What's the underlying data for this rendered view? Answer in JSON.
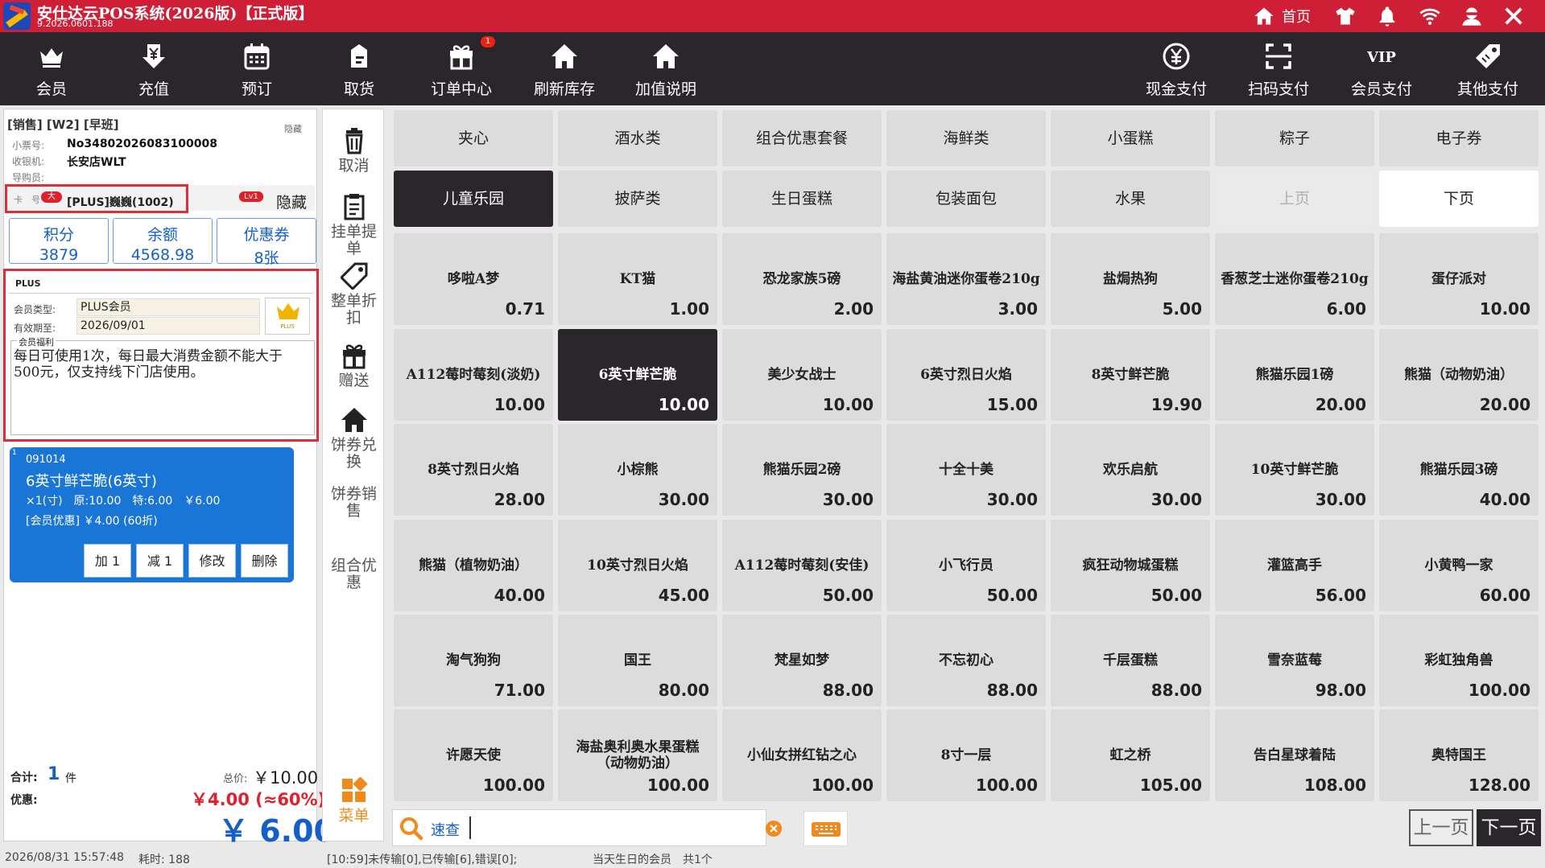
{
  "window": {
    "title": "安仕达云POS系统(2026版)【正式版】",
    "version": "9.2026.0601.188",
    "home_label": "首页"
  },
  "toolbar": {
    "left": [
      {
        "label": "会员",
        "icon": "crown-icon"
      },
      {
        "label": "充值",
        "icon": "yen-download-icon"
      },
      {
        "label": "预订",
        "icon": "calendar-icon"
      },
      {
        "label": "取货",
        "icon": "package-icon"
      },
      {
        "label": "订单中心",
        "icon": "gift-icon",
        "badge": "1"
      },
      {
        "label": "刷新库存",
        "icon": "house-icon"
      },
      {
        "label": "加值说明",
        "icon": "house-icon"
      }
    ],
    "right": [
      {
        "label": "现金支付",
        "icon": "yen-circle-icon"
      },
      {
        "label": "扫码支付",
        "icon": "scan-icon"
      },
      {
        "label": "会员支付",
        "icon": "vip-icon"
      },
      {
        "label": "其他支付",
        "icon": "tag-icon"
      }
    ]
  },
  "order": {
    "header": "[销售] [W2] [早班]",
    "hide_label": "隐藏",
    "receipt_label": "小票号:",
    "receipt_no": "No34802026083100008",
    "cashier_label": "收银机:",
    "cashier": "长安店WLT",
    "guide_label": "导购员:",
    "guide": ""
  },
  "member": {
    "card_label": "卡　号",
    "tag_big": "大",
    "name": "[PLUS]巍巍(1002)",
    "level": "Lv1",
    "hide_button": "隐藏",
    "stats": [
      {
        "label": "积分",
        "value": "3879"
      },
      {
        "label": "余额",
        "value": "4568.98"
      },
      {
        "label": "优惠券",
        "value": "8张"
      }
    ],
    "plus_tab": "PLUS",
    "type_label": "会员类型:",
    "type_value": "PLUS会员",
    "expiry_label": "有效期至:",
    "expiry_value": "2026/09/01",
    "plus_badge": "PLUS",
    "benefit_label": "会员福利",
    "benefit_text": "每日可使用1次，每日最大消费金额不能大于500元，仅支持线下门店使用。"
  },
  "cart": {
    "items": [
      {
        "index": "1",
        "code": "091014",
        "name": "6英寸鲜芒脆(6英寸)",
        "detail": "×1(寸)　原:10.00　特:6.00　￥6.00",
        "discount": "[会员优惠] ￥4.00 (60折)",
        "buttons": [
          "加 1",
          "减 1",
          "修改",
          "删除"
        ]
      }
    ]
  },
  "totals": {
    "count_label": "合计:",
    "count": "1",
    "count_unit": "件",
    "total_label": "总价:",
    "total": "￥10.00",
    "discount_label": "优惠:",
    "discount": "￥4.00 (≈60%)",
    "payable": "￥ 6.00"
  },
  "sidebar": [
    {
      "label": "取消",
      "icon": "trash-icon"
    },
    {
      "label": "挂单提单",
      "icon": "clipboard-icon"
    },
    {
      "label": "整单折扣",
      "icon": "tag-icon"
    },
    {
      "label": "赠送",
      "icon": "gift-icon"
    },
    {
      "label": "饼券兑换",
      "icon": "house-icon"
    },
    {
      "label": "饼券销售",
      "icon": ""
    },
    {
      "label": "组合优惠",
      "icon": ""
    },
    {
      "label": "菜单",
      "icon": "grid-menu-icon"
    }
  ],
  "categories": [
    "夹心",
    "酒水类",
    "组合优惠套餐",
    "海鲜类",
    "小蛋糕",
    "粽子",
    "电子券",
    "儿童乐园",
    "披萨类",
    "生日蛋糕",
    "包装面包",
    "水果",
    "上页",
    "下页"
  ],
  "products": [
    {
      "name": "哆啦A梦",
      "price": "0.71"
    },
    {
      "name": "KT猫",
      "price": "1.00"
    },
    {
      "name": "恐龙家族5磅",
      "price": "2.00"
    },
    {
      "name": "海盐黄油迷你蛋卷210g",
      "price": "3.00"
    },
    {
      "name": "盐焗热狗",
      "price": "5.00"
    },
    {
      "name": "香葱芝士迷你蛋卷210g",
      "price": "6.00"
    },
    {
      "name": "蛋仔派对",
      "price": "10.00"
    },
    {
      "name": "A112莓时莓刻(淡奶)",
      "price": "10.00"
    },
    {
      "name": "6英寸鲜芒脆",
      "price": "10.00"
    },
    {
      "name": "美少女战士",
      "price": "10.00"
    },
    {
      "name": "6英寸烈日火焰",
      "price": "15.00"
    },
    {
      "name": "8英寸鲜芒脆",
      "price": "19.90"
    },
    {
      "name": "熊猫乐园1磅",
      "price": "20.00"
    },
    {
      "name": "熊猫（动物奶油）",
      "price": "20.00"
    },
    {
      "name": "8英寸烈日火焰",
      "price": "28.00"
    },
    {
      "name": "小棕熊",
      "price": "30.00"
    },
    {
      "name": "熊猫乐园2磅",
      "price": "30.00"
    },
    {
      "name": "十全十美",
      "price": "30.00"
    },
    {
      "name": "欢乐启航",
      "price": "30.00"
    },
    {
      "name": "10英寸鲜芒脆",
      "price": "30.00"
    },
    {
      "name": "熊猫乐园3磅",
      "price": "40.00"
    },
    {
      "name": "熊猫（植物奶油）",
      "price": "40.00"
    },
    {
      "name": "10英寸烈日火焰",
      "price": "45.00"
    },
    {
      "name": "A112莓时莓刻(安佳)",
      "price": "50.00"
    },
    {
      "name": "小飞行员",
      "price": "50.00"
    },
    {
      "name": "疯狂动物城蛋糕",
      "price": "50.00"
    },
    {
      "name": "灌篮高手",
      "price": "56.00"
    },
    {
      "name": "小黄鸭一家",
      "price": "60.00"
    },
    {
      "name": "淘气狗狗",
      "price": "71.00"
    },
    {
      "name": "国王",
      "price": "80.00"
    },
    {
      "name": "梵星如梦",
      "price": "88.00"
    },
    {
      "name": "不忘初心",
      "price": "88.00"
    },
    {
      "name": "千层蛋糕",
      "price": "88.00"
    },
    {
      "name": "雪奈蓝莓",
      "price": "98.00"
    },
    {
      "name": "彩虹独角兽",
      "price": "100.00"
    },
    {
      "name": "许愿天使",
      "price": "100.00"
    },
    {
      "name": "海盐奥利奥水果蛋糕（动物奶油）",
      "price": "100.00"
    },
    {
      "name": "小仙女拼红钻之心",
      "price": "100.00"
    },
    {
      "name": "8寸一层",
      "price": "100.00"
    },
    {
      "name": "虹之桥",
      "price": "105.00"
    },
    {
      "name": "告白星球着陆",
      "price": "108.00"
    },
    {
      "name": "奥特国王",
      "price": "128.00"
    }
  ],
  "search": {
    "label": "速查",
    "value": ""
  },
  "paging": {
    "prev": "上一页",
    "next": "下一页"
  },
  "status": {
    "datetime": "2026/08/31 15:57:48",
    "elapsed": "耗时: 188",
    "sync": "[10:59]未传输[0],已传输[6],错误[0];",
    "birthday": "当天生日的会员　共1个"
  },
  "colors": {
    "title_bar": "#cf1f36",
    "toolbar": "#2a262c",
    "selected_tile": "#2a262c",
    "cart_item": "#1a76d6",
    "accent_blue": "#1560c8",
    "discount_red": "#e0202a",
    "menu_orange": "#f08a1c",
    "highlight_box": "#e02d3a"
  }
}
